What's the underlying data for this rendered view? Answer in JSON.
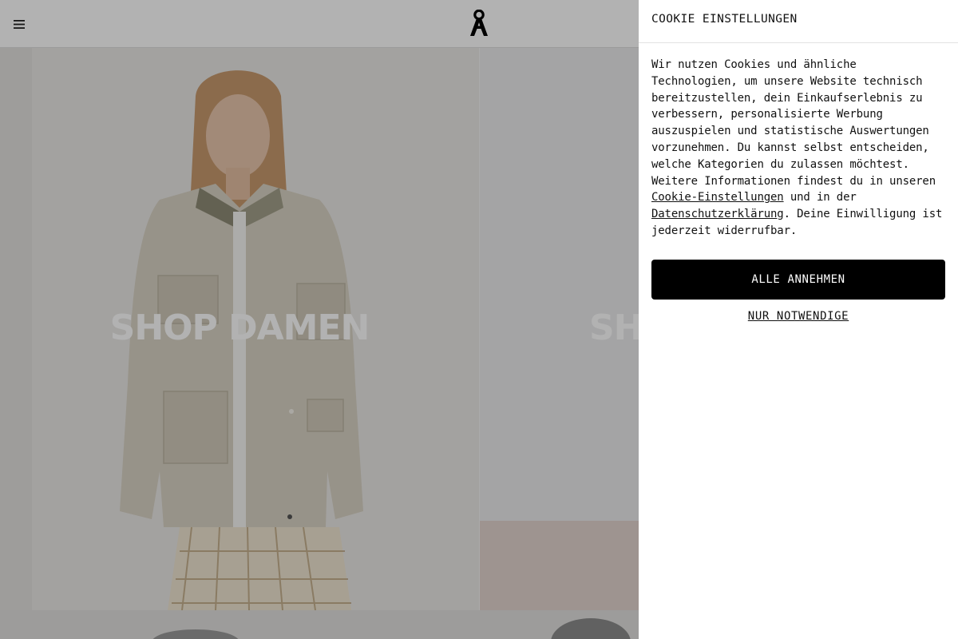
{
  "header": {
    "menu_icon": "hamburger-menu-icon",
    "logo_icon": "brand-logo-icon"
  },
  "hero": {
    "tiles": [
      {
        "title": "SHOP DAMEN"
      },
      {
        "title": "SH"
      }
    ]
  },
  "cookie": {
    "heading": "COOKIE EINSTELLUNGEN",
    "text_part1": "Wir nutzen Cookies und ähnliche Technologien, um unsere Website technisch bereitzustellen, dein Einkaufserlebnis zu verbessern, personalisierte Werbung auszuspielen und statistische Auswertungen vorzunehmen. Du kannst selbst entscheiden, welche Kategorien du zulassen möchtest. Weitere Informationen findest du in unseren ",
    "link_settings": "Cookie-Einstellungen",
    "text_part2": " und in der ",
    "link_privacy": "Datenschutzerklärung",
    "text_part3": ". Deine Einwilligung ist jederzeit widerrufbar.",
    "accept_all_label": "ALLE ANNEHMEN",
    "necessary_only_label": "NUR NOTWENDIGE"
  },
  "colors": {
    "overlay": "#000000",
    "button_bg": "#000000",
    "button_text": "#ffffff"
  }
}
